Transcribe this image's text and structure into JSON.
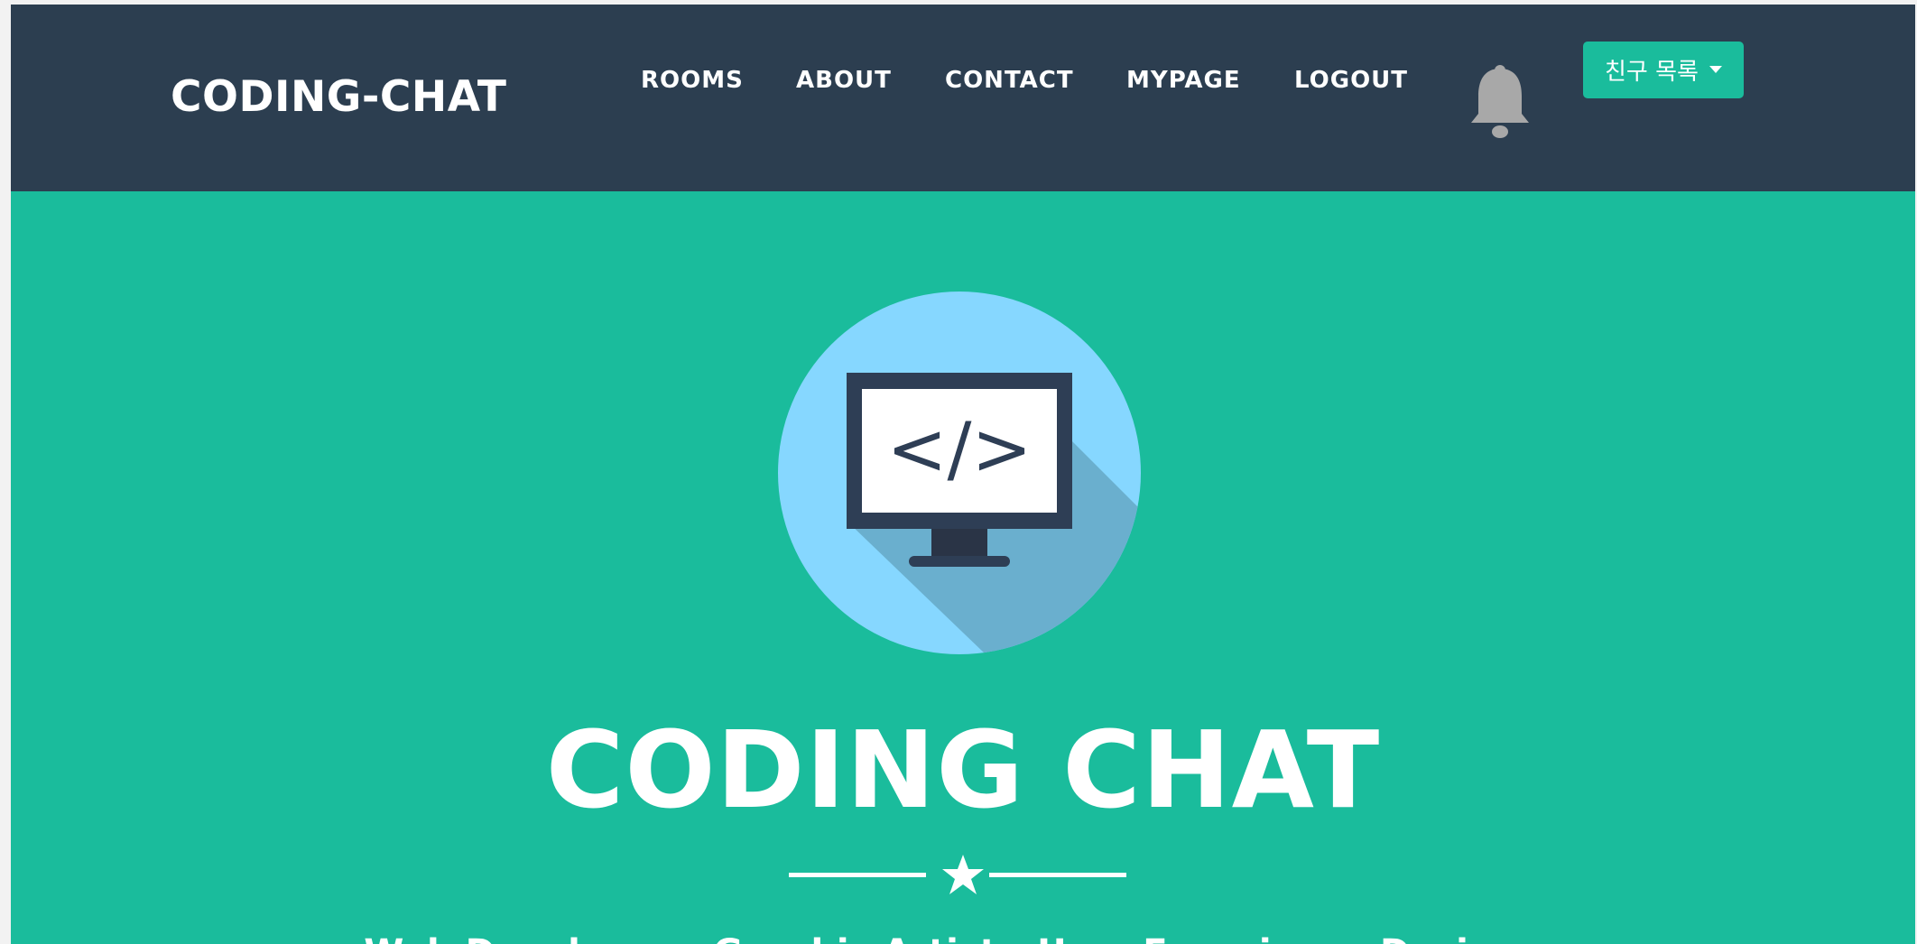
{
  "nav": {
    "brand": "CODING-CHAT",
    "links": [
      {
        "label": "ROOMS"
      },
      {
        "label": "ABOUT"
      },
      {
        "label": "CONTACT"
      },
      {
        "label": "MYPAGE"
      },
      {
        "label": "LOGOUT"
      }
    ],
    "bell_icon": "bell-icon",
    "friends_dropdown": {
      "label": "친구 목록",
      "caret_icon": "caret-down-icon"
    }
  },
  "hero": {
    "icon": "code-monitor-icon",
    "icon_text": "</>",
    "title": "CODING CHAT",
    "divider_icon": "star-icon",
    "subtitle": "Web Developer - Graphic Artist - User Experience Designer"
  },
  "colors": {
    "navbar": "#2c3e50",
    "accent": "#1abc9c",
    "icon_circle": "#86d7ff",
    "icon_shadow": "#6aafce",
    "monitor_frame": "#2e3e55",
    "bell": "#a8a8a8"
  }
}
